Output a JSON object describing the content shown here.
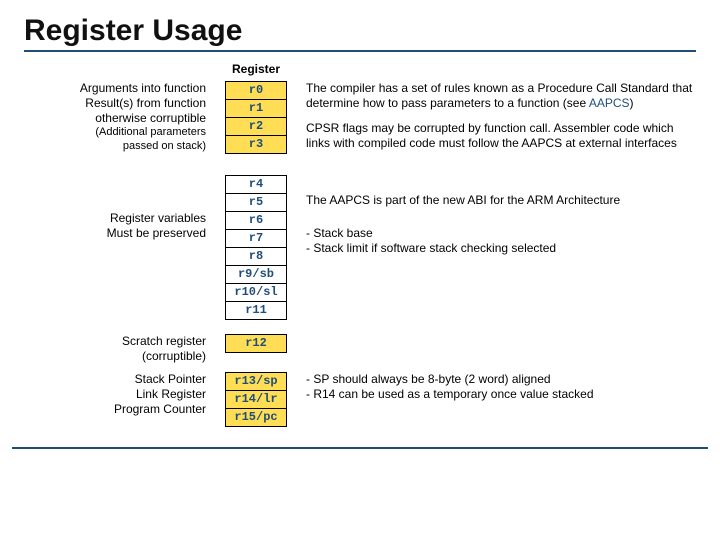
{
  "title": "Register Usage",
  "col_header": "Register",
  "groups": {
    "args": {
      "left1": "Arguments into function",
      "left2": "Result(s) from function",
      "left3": "otherwise corruptible",
      "left4a": "(",
      "left4b": "Additional parameters",
      "left5": "passed on stack)",
      "regs": [
        "r0",
        "r1",
        "r2",
        "r3"
      ]
    },
    "vars": {
      "left1": "Register variables",
      "left2": "Must be preserved",
      "regs": [
        "r4",
        "r5",
        "r6",
        "r7",
        "r8",
        "r9/sb",
        "r10/sl",
        "r11"
      ]
    },
    "scratch": {
      "left1": "Scratch register",
      "left2": "(corruptible)",
      "regs": [
        "r12"
      ]
    },
    "special": {
      "left1": "Stack Pointer",
      "left2": "Link Register",
      "left3": "Program Counter",
      "regs": [
        "r13/sp",
        "r14/lr",
        "r15/pc"
      ]
    }
  },
  "right": {
    "p1a": "The compiler has a set of rules known as a Procedure Call Standard that determine how to pass parameters to a function (see ",
    "p1b": "AAPCS",
    "p1c": ")",
    "p2": "CPSR flags may be corrupted by function call. Assembler code which links with compiled code must follow the AAPCS at external interfaces",
    "p3": "The AAPCS is part of the new ABI for the ARM Architecture",
    "sb": "- Stack base",
    "sl": "- Stack limit if software stack checking selected",
    "sp": "- SP should always be 8-byte (2 word) aligned",
    "lr": "- R14 can be used as a temporary once value stacked"
  }
}
